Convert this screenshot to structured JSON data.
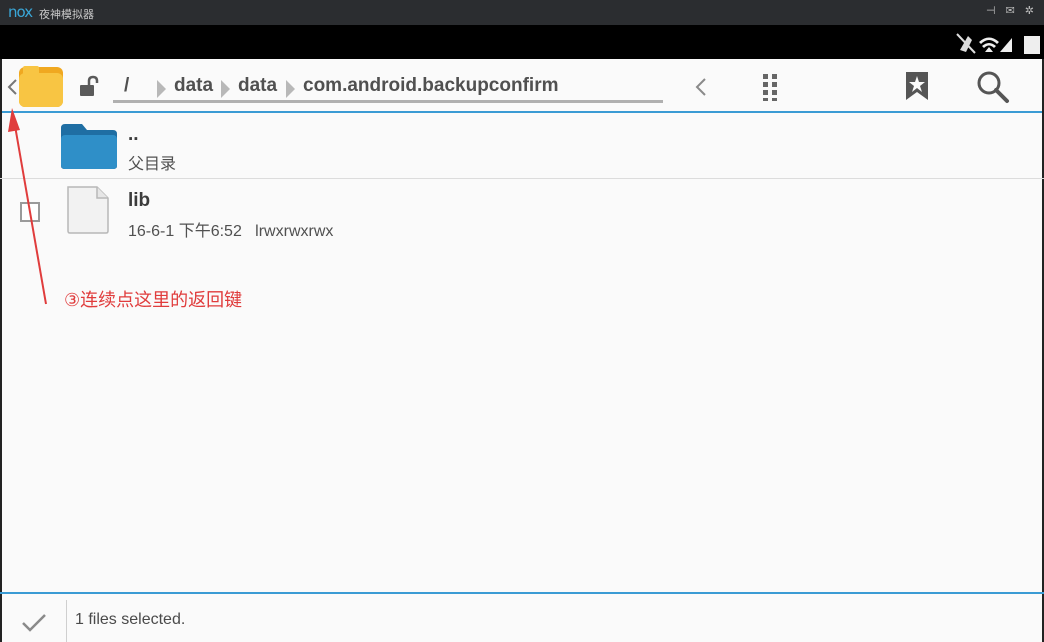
{
  "emulator": {
    "logo": "nox",
    "title": "夜神模拟器",
    "controls": [
      "pin-icon",
      "mail-icon",
      "settings-icon"
    ]
  },
  "toolbar": {
    "back_icon": "chevron-left-icon",
    "root": "/",
    "crumbs": [
      "data",
      "data",
      "com.android.backupconfirm"
    ]
  },
  "list": {
    "parent": {
      "name": "..",
      "label": "父目录"
    },
    "items": [
      {
        "name": "lib",
        "meta": "16-6-1 下午6:52   lrwxrwxrwx",
        "checked": false
      }
    ]
  },
  "bottom": {
    "status": "1 files selected."
  },
  "annotation": {
    "text": "③连续点这里的返回键"
  },
  "colors": {
    "accent": "#3a9bd4",
    "folder": "#f4b942",
    "annotation": "#e03c3c"
  }
}
